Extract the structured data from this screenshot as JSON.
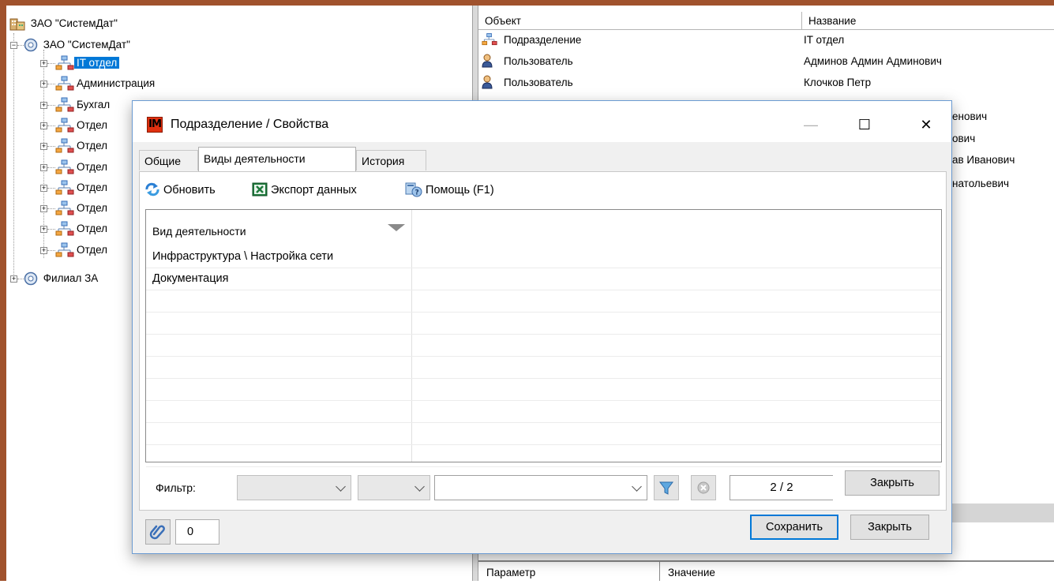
{
  "tree": {
    "root_label": "ЗАО \"СистемДат\"",
    "org_label": "ЗАО \"СистемДат\"",
    "departments": [
      "IT отдел",
      "Администрация",
      "Бухгал",
      "Отдел",
      "Отдел",
      "Отдел",
      "Отдел",
      "Отдел",
      "Отдел",
      "Отдел"
    ],
    "branch_label": "Филиал ЗА",
    "selected_index": 0,
    "expander_plus": "+",
    "expander_minus": "−"
  },
  "right_grid": {
    "columns": [
      "Объект",
      "Название"
    ],
    "rows": [
      {
        "object": "Подразделение",
        "name": "IT отдел",
        "icon": "department-icon"
      },
      {
        "object": "Пользователь",
        "name": "Админов Админ Админович",
        "icon": "user-icon"
      },
      {
        "object": "Пользователь",
        "name": "Клочков Петр",
        "icon": "user-icon"
      }
    ],
    "overflow_names": [
      "енович",
      "ович",
      "ав Иванович",
      "натольевич"
    ],
    "bottom_columns": [
      "Параметр",
      "Значение"
    ]
  },
  "dialog": {
    "logo_text": "IM",
    "title": "Подразделение / Свойства",
    "minimize_symbol": "—",
    "maximize_symbol": "☐",
    "close_symbol": "✕",
    "tabs": [
      "Общие",
      "Виды деятельности",
      "История"
    ],
    "active_tab": 1,
    "toolbar": {
      "refresh_label": "Обновить",
      "export_label": "Экспорт данных",
      "help_label": "Помощь (F1)"
    },
    "grid": {
      "column_header": "Вид деятельности",
      "rows": [
        "Инфраструктура \\ Настройка сети",
        "Документация"
      ]
    },
    "filter": {
      "label": "Фильтр:",
      "combo1_value": "",
      "combo2_value": "",
      "combo3_value": "",
      "counter": "2 / 2",
      "close_label": "Закрыть"
    },
    "footer": {
      "attachments_count": "0",
      "save_label": "Сохранить",
      "close_label": "Закрыть"
    }
  }
}
